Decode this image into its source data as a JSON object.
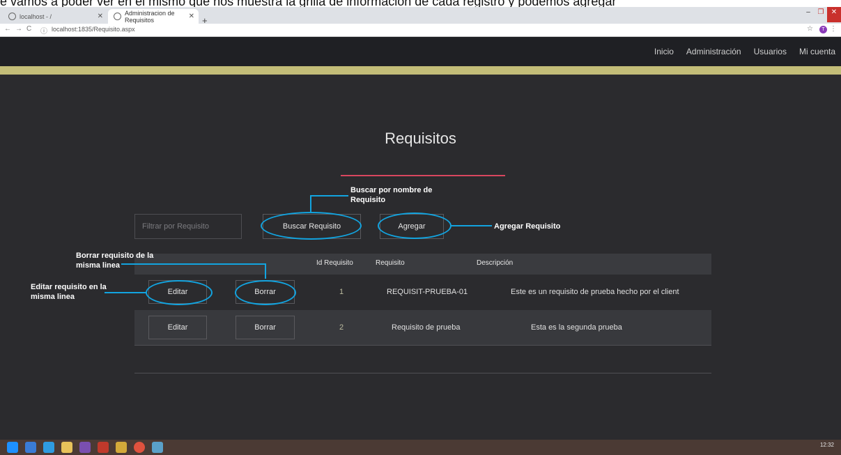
{
  "doc_fragment": "e vamos a poder ver en el mismo que nos muestra la grilla de información de cada registro y podemos agregar",
  "browser": {
    "tabs": [
      {
        "label": "localhost - /"
      },
      {
        "label": "Administracion de Requisitos"
      }
    ],
    "new_tab": "+",
    "url": "localhost:1835/Requisito.aspx",
    "profile_initial": "T"
  },
  "nav": {
    "items": [
      "Inicio",
      "Administración",
      "Usuarios",
      "Mi cuenta"
    ]
  },
  "page": {
    "title": "Requisitos",
    "filter_placeholder": "Filtrar por Requisito",
    "search_label": "Buscar Requisito",
    "add_label": "Agregar"
  },
  "table": {
    "headers": [
      "Id Requisito",
      "Requisito",
      "Descripción"
    ],
    "edit_label": "Editar",
    "delete_label": "Borrar",
    "rows": [
      {
        "id": "1",
        "requisito": "REQUISIT-PRUEBA-01",
        "descripcion": "Este es un requisito de prueba hecho por el client"
      },
      {
        "id": "2",
        "requisito": "Requisito de prueba",
        "descripcion": "Esta es la segunda prueba"
      }
    ]
  },
  "annotations": {
    "search": [
      "Buscar por nombre de",
      "Requisito"
    ],
    "add": "Agregar Requisito",
    "delete": [
      "Borrar requisito de la",
      "misma linea"
    ],
    "edit": [
      "Editar requisito en la",
      "misma linea"
    ],
    "color": "#12a4e0"
  },
  "taskbar": {
    "time": "12:32"
  },
  "colors": {
    "page_bg": "#2b2b2e",
    "nav_bg": "#1f2024",
    "accent_bar": "#c3bd78",
    "title_underline": "#d9475e"
  }
}
